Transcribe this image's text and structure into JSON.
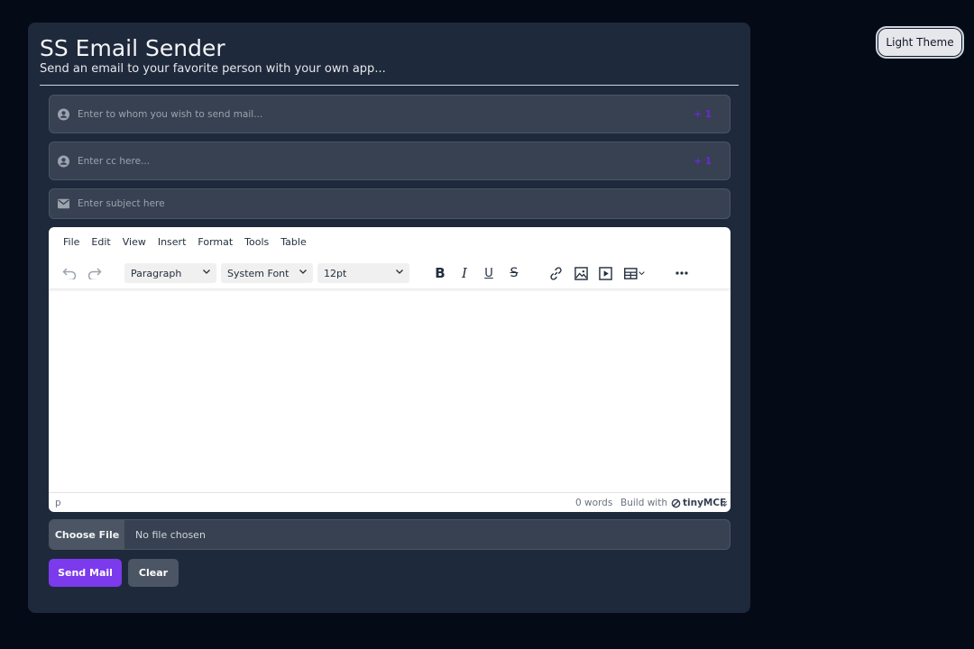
{
  "header": {
    "title": "SS Email Sender",
    "subtitle": "Send an email to your favorite person with your own app..."
  },
  "theme_toggle": {
    "label": "Light Theme"
  },
  "fields": {
    "to": {
      "placeholder": "Enter to whom you wish to send mail...",
      "add_label": "+ 1",
      "icon": "user-circle-icon"
    },
    "cc": {
      "placeholder": "Enter cc here...",
      "add_label": "+ 1",
      "icon": "user-circle-icon"
    },
    "subject": {
      "placeholder": "Enter subject here",
      "icon": "envelope-icon"
    }
  },
  "editor": {
    "menu": [
      "File",
      "Edit",
      "View",
      "Insert",
      "Format",
      "Tools",
      "Table"
    ],
    "block_format": "Paragraph",
    "font_family": "System Font",
    "font_size": "12pt",
    "status_path": "p",
    "word_count": "0 words",
    "build_prefix": "Build with",
    "brand": "tinyMCE"
  },
  "attachment": {
    "button_label": "Choose File",
    "status": "No file chosen"
  },
  "actions": {
    "send_label": "Send Mail",
    "clear_label": "Clear"
  },
  "colors": {
    "page_bg": "#050a17",
    "card_bg": "#1e293b",
    "accent": "#7c3aed",
    "field_bg": "#374151"
  }
}
